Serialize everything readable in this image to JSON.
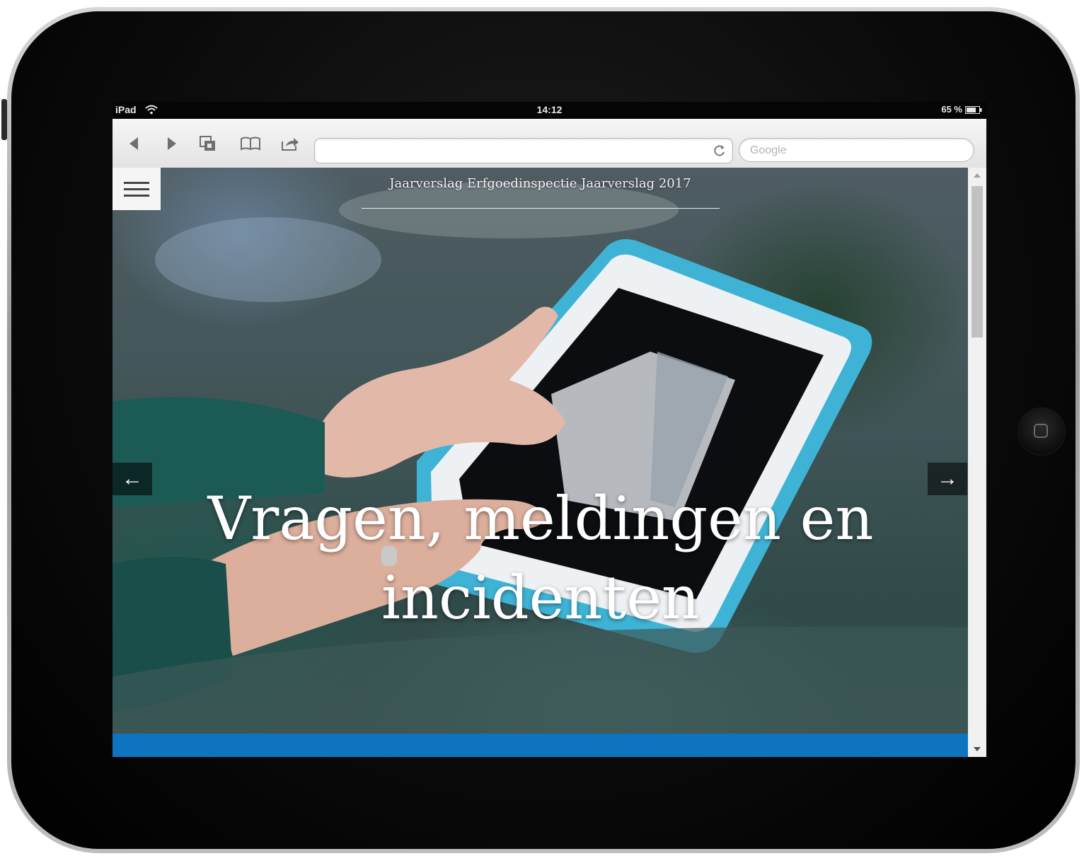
{
  "statusbar": {
    "device": "iPad",
    "time": "14:12",
    "battery": "65 %"
  },
  "browser": {
    "url": "",
    "search_placeholder": "Google",
    "icons": [
      "back-icon",
      "forward-icon",
      "tabs-icon",
      "bookmarks-icon",
      "share-icon",
      "reload-icon"
    ]
  },
  "page": {
    "site_title": "Jaarverslag Erfgoedinspectie Jaarverslag 2017",
    "headline_line1": "Vragen, meldingen en",
    "headline_line2": "incidenten",
    "prev_arrow": "←",
    "next_arrow": "→"
  },
  "colors": {
    "accent_bar": "#0f74c0",
    "tablet_case": "#3fb3d6"
  }
}
